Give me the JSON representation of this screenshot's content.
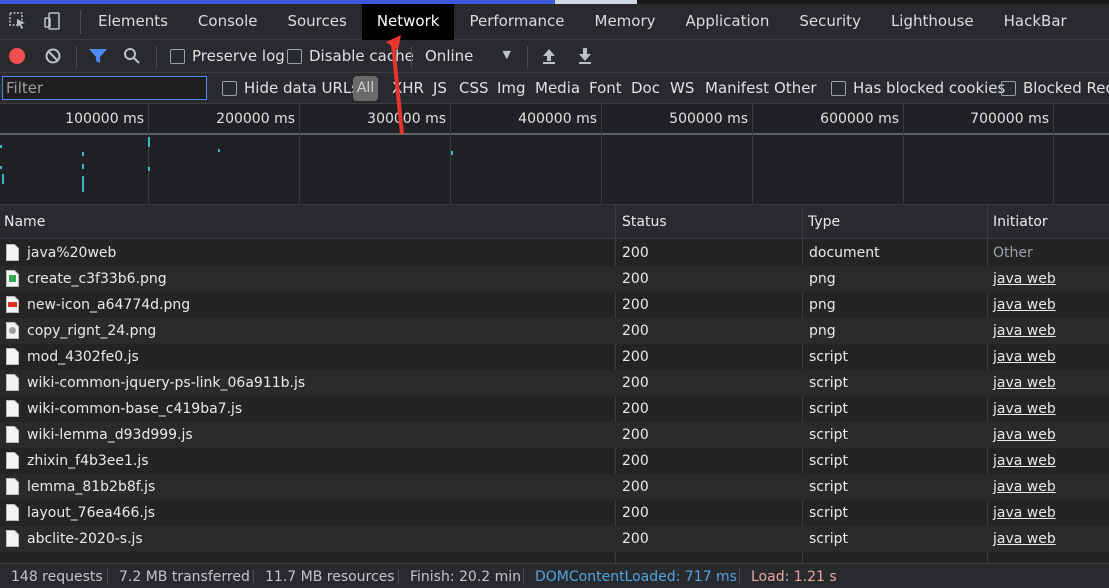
{
  "tabbar": {
    "tabs": [
      {
        "label": "Elements",
        "active": false
      },
      {
        "label": "Console",
        "active": false
      },
      {
        "label": "Sources",
        "active": false
      },
      {
        "label": "Network",
        "active": true
      },
      {
        "label": "Performance",
        "active": false
      },
      {
        "label": "Memory",
        "active": false
      },
      {
        "label": "Application",
        "active": false
      },
      {
        "label": "Security",
        "active": false
      },
      {
        "label": "Lighthouse",
        "active": false
      },
      {
        "label": "HackBar",
        "active": false
      }
    ]
  },
  "toolbar": {
    "preserve_log": "Preserve log",
    "disable_cache": "Disable cache",
    "throttling": "Online"
  },
  "filterbar": {
    "placeholder": "Filter",
    "hide_data_urls": "Hide data URLs",
    "all": "All",
    "types": [
      "XHR",
      "JS",
      "CSS",
      "Img",
      "Media",
      "Font",
      "Doc",
      "WS",
      "Manifest",
      "Other"
    ],
    "has_blocked_cookies": "Has blocked cookies",
    "blocked_requests": "Blocked Requests"
  },
  "overview": {
    "ticks": [
      "100000 ms",
      "200000 ms",
      "300000 ms",
      "400000 ms",
      "500000 ms",
      "600000 ms",
      "700000 ms"
    ]
  },
  "table": {
    "columns": {
      "name": "Name",
      "status": "Status",
      "type": "Type",
      "initiator": "Initiator"
    },
    "rows": [
      {
        "name": "java%20web",
        "status": "200",
        "type": "document",
        "initiator": "Other",
        "icon": "doc"
      },
      {
        "name": "create_c3f33b6.png",
        "status": "200",
        "type": "png",
        "initiator": "java web",
        "icon": "img-green"
      },
      {
        "name": "new-icon_a64774d.png",
        "status": "200",
        "type": "png",
        "initiator": "java web",
        "icon": "img-red"
      },
      {
        "name": "copy_rignt_24.png",
        "status": "200",
        "type": "png",
        "initiator": "java web",
        "icon": "img-gray"
      },
      {
        "name": "mod_4302fe0.js",
        "status": "200",
        "type": "script",
        "initiator": "java web",
        "icon": "doc"
      },
      {
        "name": "wiki-common-jquery-ps-link_06a911b.js",
        "status": "200",
        "type": "script",
        "initiator": "java web",
        "icon": "doc"
      },
      {
        "name": "wiki-common-base_c419ba7.js",
        "status": "200",
        "type": "script",
        "initiator": "java web",
        "icon": "doc"
      },
      {
        "name": "wiki-lemma_d93d999.js",
        "status": "200",
        "type": "script",
        "initiator": "java web",
        "icon": "doc"
      },
      {
        "name": "zhixin_f4b3ee1.js",
        "status": "200",
        "type": "script",
        "initiator": "java web",
        "icon": "doc"
      },
      {
        "name": "lemma_81b2b8f.js",
        "status": "200",
        "type": "script",
        "initiator": "java web",
        "icon": "doc"
      },
      {
        "name": "layout_76ea466.js",
        "status": "200",
        "type": "script",
        "initiator": "java web",
        "icon": "doc"
      },
      {
        "name": "abclite-2020-s.js",
        "status": "200",
        "type": "script",
        "initiator": "java web",
        "icon": "doc"
      }
    ]
  },
  "statusbar": {
    "requests": "148 requests",
    "transferred": "7.2 MB transferred",
    "resources": "11.7 MB resources",
    "finish": "Finish: 20.2 min",
    "domcontentloaded": "DOMContentLoaded: 717 ms",
    "load": "Load: 1.21 s"
  },
  "colors": {
    "accent": "#4c8bf5",
    "record": "#ef4f4f",
    "dcl": "#4fa3e0",
    "load": "#e7a89e",
    "arrow": "#e8342e"
  }
}
